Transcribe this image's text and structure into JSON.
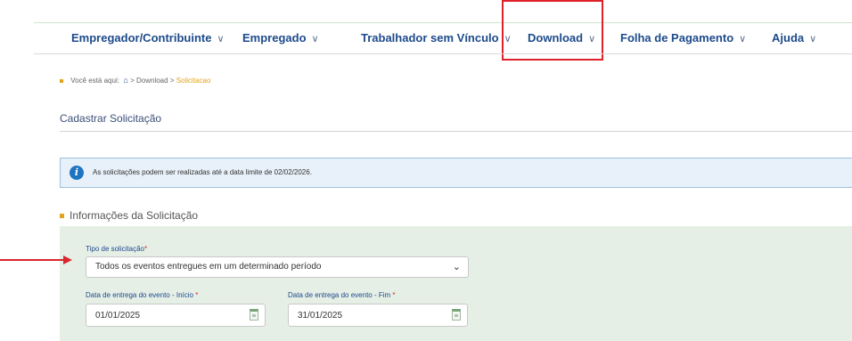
{
  "nav": {
    "items": [
      {
        "label": "Empregador/Contribuinte"
      },
      {
        "label": "Empregado"
      },
      {
        "label": "Trabalhador sem Vínculo"
      },
      {
        "label": "Download"
      },
      {
        "label": "Folha de Pagamento"
      },
      {
        "label": "Ajuda"
      }
    ],
    "chevron": "∨"
  },
  "breadcrumb": {
    "prefix": "Você está aqui:",
    "home_icon": "home-icon",
    "sep1": ">",
    "item1": "Download",
    "sep2": ">",
    "current": "Solicitacao"
  },
  "page": {
    "title": "Cadastrar Solicitação"
  },
  "alert": {
    "icon": "info-icon",
    "icon_glyph": "i",
    "message": "As solicitações podem ser realizadas até a data limite de 02/02/2026."
  },
  "section": {
    "title": "Informações da Solicitação"
  },
  "form": {
    "tipo_label": "Tipo de solicitação",
    "required_mark": "*",
    "tipo_value": "Todos os eventos entregues em um determinado período",
    "select_chevron": "⌄",
    "inicio_label": "Data de entrega do evento - Início",
    "inicio_value": "01/01/2025",
    "fim_label": "Data de entrega do evento - Fim",
    "fim_value": "31/01/2025"
  },
  "colors": {
    "nav_text": "#1d4a8c",
    "highlight": "#e0202a",
    "accent": "#e3a21a",
    "panel_bg": "#e6efe6",
    "info_bg": "#e8f1f9"
  }
}
